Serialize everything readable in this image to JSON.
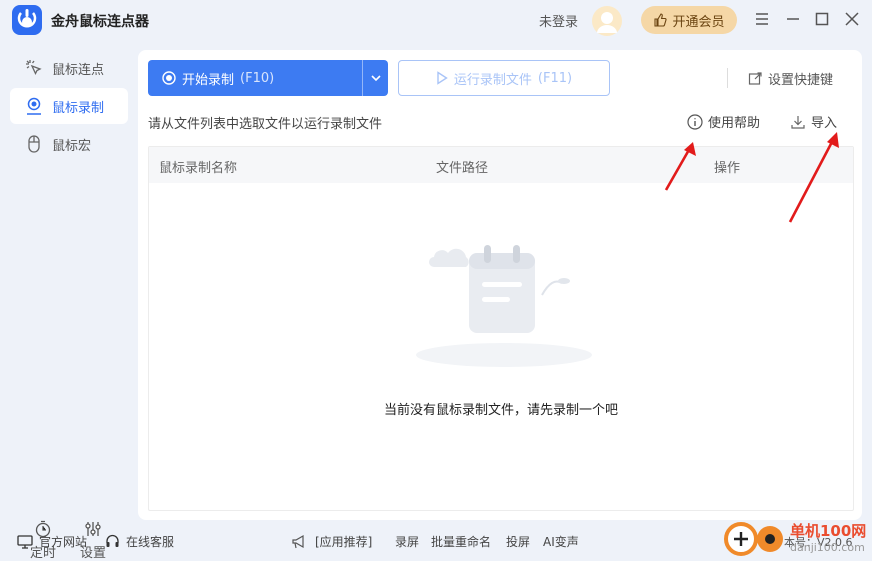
{
  "window": {
    "title": "金舟鼠标连点器",
    "login_text": "未登录",
    "vip_button": "开通会员"
  },
  "sidebar": {
    "items": [
      {
        "label": "鼠标连点",
        "icon": "click-burst-icon"
      },
      {
        "label": "鼠标录制",
        "icon": "record-user-icon",
        "active": true
      },
      {
        "label": "鼠标宏",
        "icon": "mouse-icon"
      }
    ],
    "bottom": [
      {
        "label": "定时",
        "icon": "timer-icon"
      },
      {
        "label": "设置",
        "icon": "sliders-icon"
      }
    ]
  },
  "toolbar": {
    "record_label": "开始录制",
    "record_hotkey": "(F10)",
    "run_label": "运行录制文件",
    "run_hotkey": "(F11)",
    "shortcut_label": "设置快捷键"
  },
  "hint": "请从文件列表中选取文件以运行录制文件",
  "help_label": "使用帮助",
  "import_label": "导入",
  "table": {
    "columns": [
      "鼠标录制名称",
      "文件路径",
      "操作"
    ],
    "rows": [],
    "empty_text": "当前没有鼠标录制文件，请先录制一个吧"
  },
  "footer": {
    "website": "官方网站",
    "service": "在线客服",
    "recommend": "[应用推荐]",
    "links": [
      "录屏",
      "批量重命名",
      "投屏",
      "AI变声"
    ],
    "version_text": "本号：V2.0.6"
  },
  "watermark": {
    "line1": "单机100网",
    "line2": "danji100.com"
  },
  "colors": {
    "accent": "#3d7bf2",
    "vip_bg": "#f5d7a6",
    "arrow": "#e21b1b"
  }
}
